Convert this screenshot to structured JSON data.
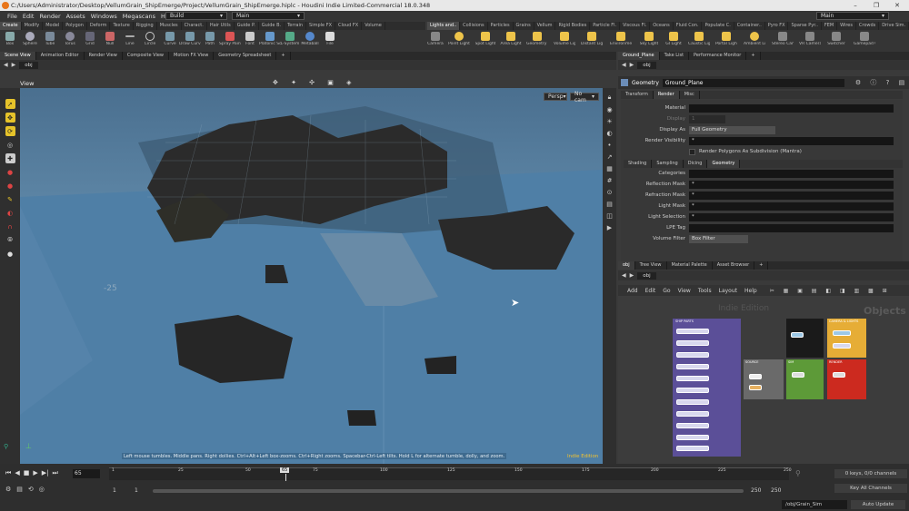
{
  "window": {
    "title": "C:/Users/Administrator/Desktop/VellumGrain_ShipEmerge/Project/VellumGrain_ShipEmerge.hiplc - Houdini Indie Limited-Commercial 18.0.348",
    "controls": [
      "–",
      "❐",
      "✕"
    ]
  },
  "menu": {
    "items": [
      "File",
      "Edit",
      "Render",
      "Assets",
      "Windows",
      "Megascans",
      "Help"
    ],
    "desktop_left": "Build",
    "desktop_mid": "Main",
    "desktop_right": "Main"
  },
  "shelf_tabs_left": [
    "Create",
    "Modify",
    "Model",
    "Polygon",
    "Deform",
    "Texture",
    "Rigging",
    "Muscles",
    "Charact.",
    "Hair Utils",
    "Guide P.",
    "Guide B.",
    "Terrain",
    "Simple FX",
    "Cloud FX",
    "Volume"
  ],
  "shelf_tabs_right": [
    "Lights and..",
    "Collisions",
    "Particles",
    "Grains",
    "Vellum",
    "Rigid Bodies",
    "Particle Fl.",
    "Viscous Fl.",
    "Oceans",
    "Fluid Con.",
    "Populate C.",
    "Container..",
    "Pyro FX",
    "Sparse Pyr..",
    "FEM",
    "Wires",
    "Crowds",
    "Drive Sim."
  ],
  "tools_left": [
    "Box",
    "Sphere",
    "Tube",
    "Torus",
    "Grid",
    "Null",
    "Line",
    "Circle",
    "Curve",
    "Draw Curve",
    "Path",
    "Spray Paint",
    "Font",
    "Platonic Solids",
    "L-System",
    "Metaball",
    "File"
  ],
  "tools_right": [
    "Camera",
    "Point Light",
    "Spot Light",
    "Area Light",
    "Geometry Light",
    "Volume Light",
    "Distant Light",
    "Environment Light",
    "Sky Light",
    "GI Light",
    "Caustic Light",
    "Portal Light",
    "Ambient Light",
    "Stereo Camera",
    "VR Camera",
    "Switcher",
    "Gamepad Camera"
  ],
  "viewport": {
    "tabs": [
      "Scene View",
      "Animation Editor",
      "Render View",
      "Composite View",
      "Motion FX View",
      "Geometry Spreadsheet"
    ],
    "path": "obj",
    "label": "View",
    "persp": "Persp",
    "cam": "No cam",
    "status": "Left mouse tumbles. Middle pans. Right dollies. Ctrl+Alt+Left box-zooms. Ctrl+Right zooms. Spacebar-Ctrl-Left tilts. Hold L for alternate tumble, dolly, and zoom.",
    "edition": "Indie Edition",
    "axis_num": "-25"
  },
  "params": {
    "tabs": [
      "Ground_Plane",
      "Take List",
      "Performance Monitor"
    ],
    "path": "obj",
    "type": "Geometry",
    "name": "Ground_Plane",
    "subtabs": [
      "Transform",
      "Render",
      "Misc"
    ],
    "rows": [
      {
        "label": "Material",
        "value": ""
      },
      {
        "label": "Display",
        "value": "1"
      },
      {
        "label": "Display As",
        "value": "Full Geometry"
      },
      {
        "label": "Render Visibility",
        "value": "*"
      }
    ],
    "checkbox": "Render Polygons As Subdivision (Mantra)",
    "subtabs2": [
      "Shading",
      "Sampling",
      "Dicing",
      "Geometry"
    ],
    "rows2": [
      {
        "label": "Categories",
        "value": ""
      },
      {
        "label": "Reflection Mask",
        "value": "*"
      },
      {
        "label": "Refraction Mask",
        "value": "*"
      },
      {
        "label": "Light Mask",
        "value": "*"
      },
      {
        "label": "Light Selection",
        "value": "*"
      },
      {
        "label": "LPE Tag",
        "value": ""
      },
      {
        "label": "Volume Filter",
        "value": "Box Filter"
      }
    ]
  },
  "network": {
    "tabs": [
      "obj",
      "Tree View",
      "Material Palette",
      "Asset Browser"
    ],
    "path": "obj",
    "menu": [
      "Add",
      "Edit",
      "Go",
      "View",
      "Tools",
      "Layout",
      "Help"
    ],
    "watermark": "Indie Edition",
    "context": "Objects",
    "box_labels": [
      "SHIP PARTS",
      "CAMERA & LIGHTS",
      "SOURCE",
      "SIM",
      "RENDER"
    ]
  },
  "timeline": {
    "frame": "65",
    "ticks": [
      "1",
      "25",
      "50",
      "65",
      "75",
      "100",
      "125",
      "150",
      "175",
      "200",
      "225",
      "250"
    ],
    "start": "1",
    "start2": "1",
    "end": "250",
    "end2": "250",
    "keys": "0 keys, 0/0 channels",
    "keyall": "Key All Channels",
    "path": "/obj/Grain_Sim",
    "update": "Auto Update"
  }
}
